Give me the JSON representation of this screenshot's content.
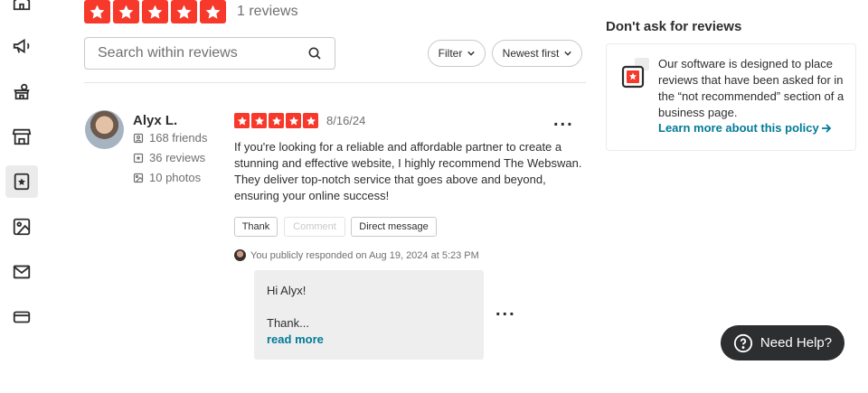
{
  "sidebar": {
    "icons": [
      "home-icon",
      "megaphone-icon",
      "shop-profile-icon",
      "storefront-icon",
      "reviews-star-icon",
      "photos-icon",
      "mail-icon",
      "credit-card-icon"
    ],
    "active": "reviews-star-icon"
  },
  "rating_summary": {
    "stars": 5,
    "count_label": "1 reviews"
  },
  "search": {
    "placeholder": "Search within reviews"
  },
  "filters": {
    "filter_label": "Filter",
    "sort_label": "Newest first"
  },
  "review": {
    "user": {
      "name": "Alyx L.",
      "friends": "168 friends",
      "reviews": "36 reviews",
      "photos": "10 photos"
    },
    "stars": 5,
    "date": "8/16/24",
    "text": "If you're looking for a reliable and affordable partner to create a stunning and effective website, I highly recommend The Webswan. They deliver top-notch service that goes above and beyond, ensuring your online success!",
    "actions": {
      "thank": "Thank",
      "comment": "Comment",
      "message": "Direct message"
    },
    "more": "..."
  },
  "response": {
    "meta": "You publicly responded on Aug 19, 2024 at 5:23 PM",
    "greeting": "Hi Alyx!",
    "body": "Thank...",
    "read_more": "read more",
    "more": "..."
  },
  "aside": {
    "title": "Don't ask for reviews",
    "text": "Our software is designed to place reviews that have been asked for in the “not recommended” section of a business page.",
    "link": "Learn more about this policy"
  },
  "help": {
    "label": "Need Help?"
  },
  "colors": {
    "star_red": "#f7392b",
    "link_teal": "#027a97",
    "dark": "#2d2e2f"
  }
}
